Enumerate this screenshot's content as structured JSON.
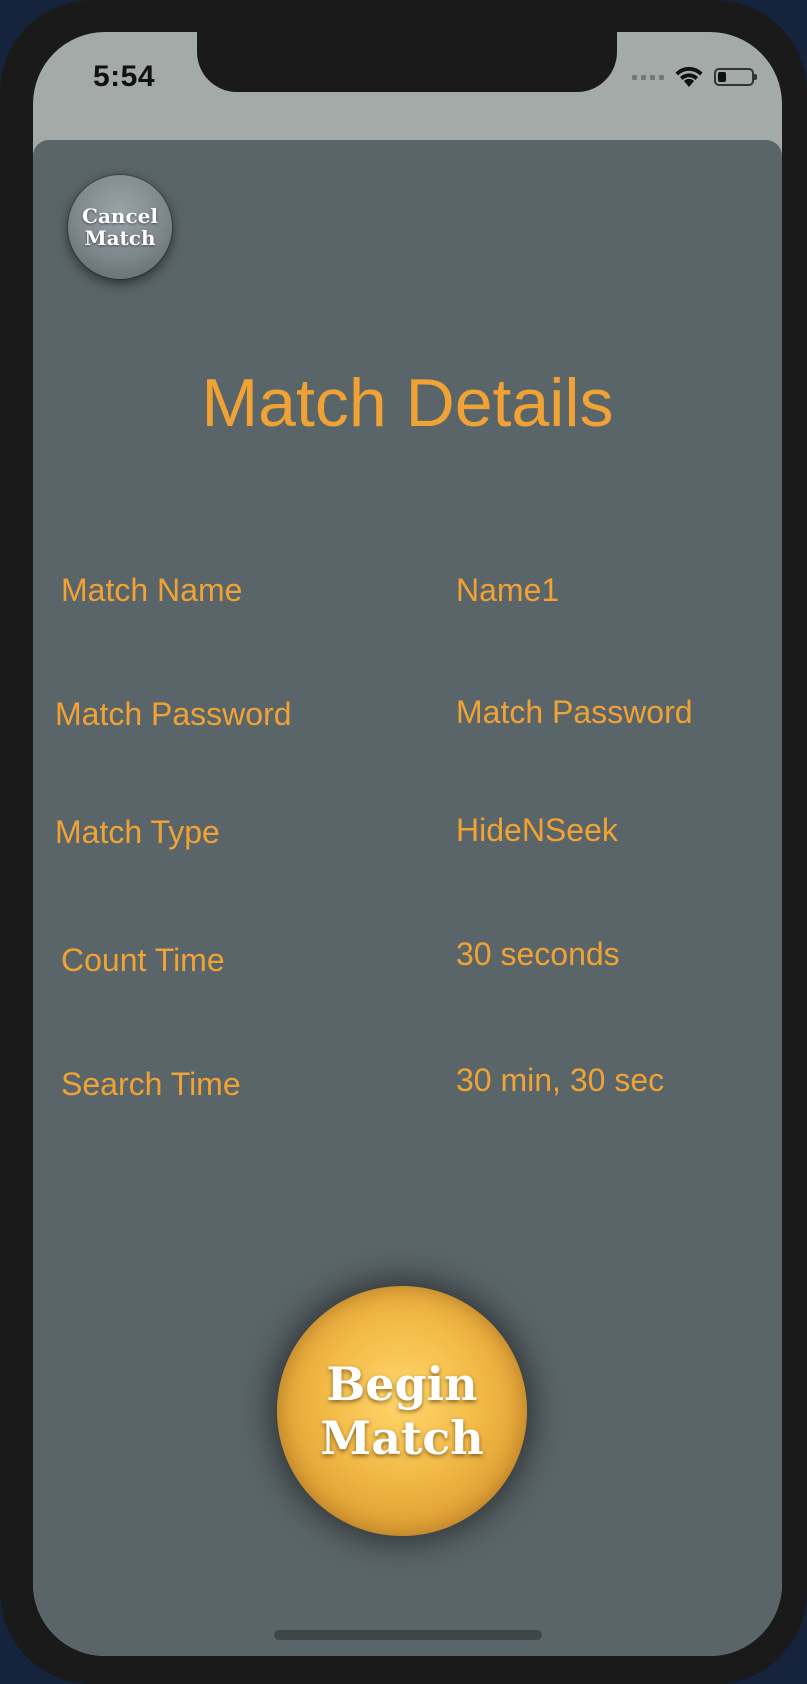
{
  "status_bar": {
    "time": "5:54",
    "battery_level": 0.25
  },
  "cancel_button": {
    "line1": "Cancel",
    "line2": "Match"
  },
  "title": "Match Details",
  "details": [
    {
      "label": "Match Name",
      "value": "Name1"
    },
    {
      "label": "Match Password",
      "value": "Match Password"
    },
    {
      "label": "Match Type",
      "value": "HideNSeek"
    },
    {
      "label": "Count Time",
      "value": "30 seconds"
    },
    {
      "label": "Search Time",
      "value": "30 min, 30 sec"
    }
  ],
  "begin_button": {
    "line1": "Begin",
    "line2": "Match"
  },
  "colors": {
    "accent": "#f0a235",
    "panel": "#5a6569",
    "button_gold": "#f3bb48"
  },
  "icons": [
    "cellular-signal-icon",
    "wifi-icon",
    "battery-icon"
  ]
}
